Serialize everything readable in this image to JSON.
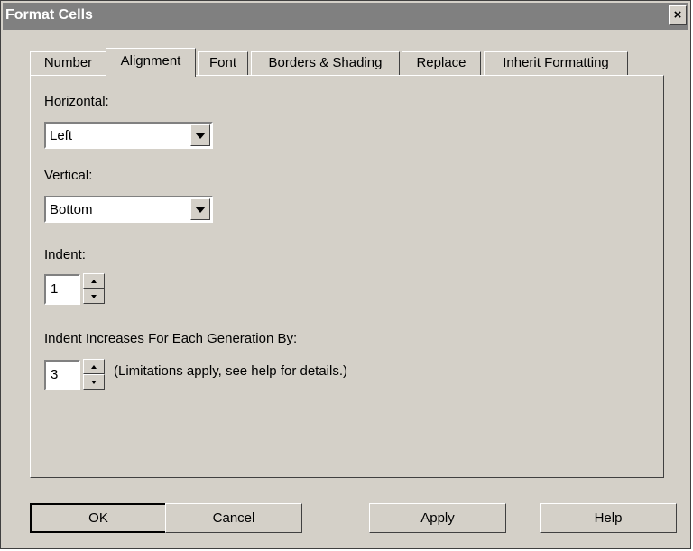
{
  "window": {
    "title": "Format Cells",
    "close_glyph": "×"
  },
  "tabs": [
    {
      "label": "Number",
      "active": false
    },
    {
      "label": "Alignment",
      "active": true
    },
    {
      "label": "Font",
      "active": false
    },
    {
      "label": "Borders & Shading",
      "active": false
    },
    {
      "label": "Replace",
      "active": false
    },
    {
      "label": "Inherit Formatting",
      "active": false
    }
  ],
  "alignment": {
    "horizontal": {
      "label": "Horizontal:",
      "value": "Left"
    },
    "vertical": {
      "label": "Vertical:",
      "value": "Bottom"
    },
    "indent": {
      "label": "Indent:",
      "value": "1"
    },
    "generation_indent": {
      "label": "Indent Increases For Each Generation By:",
      "value": "3",
      "note": "(Limitations apply, see help for details.)"
    }
  },
  "buttons": {
    "ok": "OK",
    "cancel": "Cancel",
    "apply": "Apply",
    "help": "Help"
  },
  "colors": {
    "face": "#d4d0c8",
    "title_bar": "#808080",
    "title_text": "#ffffff"
  },
  "icons": {
    "close": "close-icon",
    "dropdown": "chevron-down-icon",
    "spin_up": "spin-up-icon",
    "spin_down": "spin-down-icon"
  }
}
